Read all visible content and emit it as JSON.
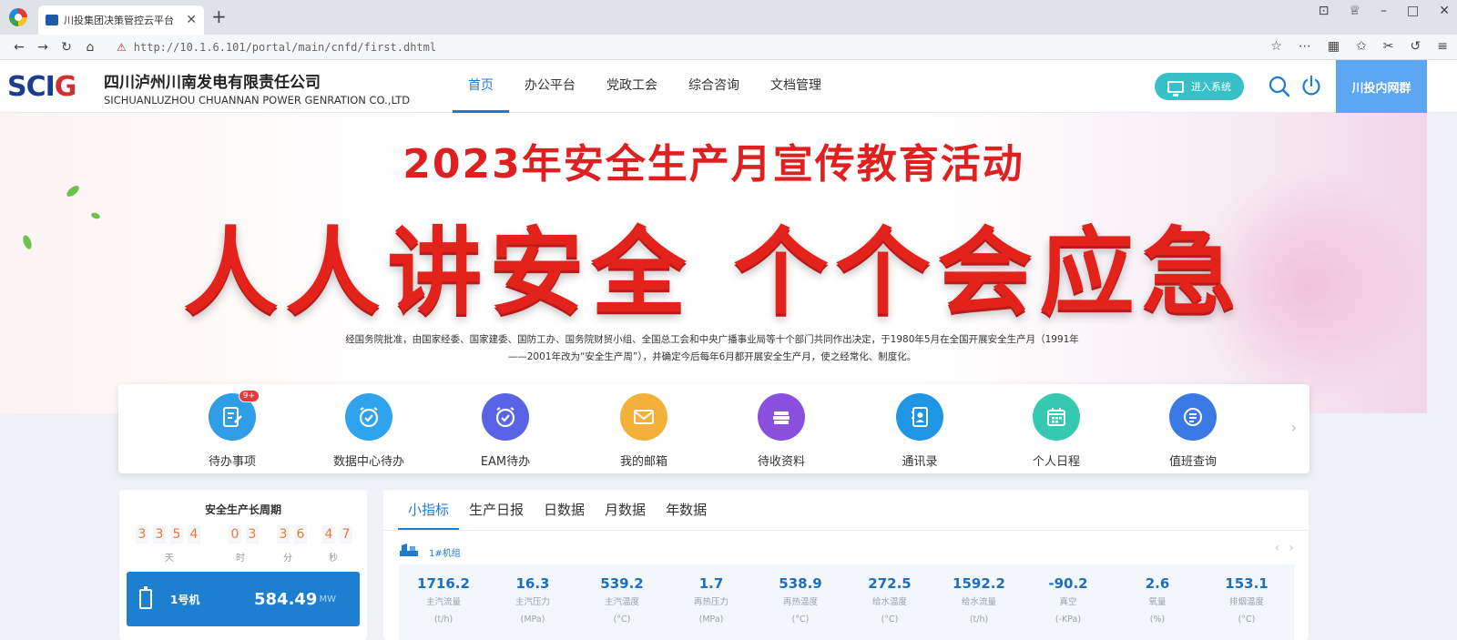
{
  "browser": {
    "tab_title": "川投集团决策管控云平台",
    "url": "http://10.1.6.101/portal/main/cnfd/first.dhtml"
  },
  "header": {
    "logo_text_main": "SCI",
    "logo_text_g": "G",
    "company_cn": "四川泸州川南发电有限责任公司",
    "company_en": "SICHUANLUZHOU CHUANNAN POWER GENRATION CO.,LTD",
    "nav": [
      "首页",
      "办公平台",
      "党政工会",
      "综合咨询",
      "文档管理"
    ],
    "enter_system": "进入系统",
    "intranet": "川投内网群"
  },
  "banner": {
    "title": "2023年安全生产月宣传教育活动",
    "slogan": "人人讲安全 个个会应急",
    "description_line1": "经国务院批准，由国家经委、国家建委、国防工办、国务院财贸小组、全国总工会和中央广播事业局等十个部门共同作出决定，于1980年5月在全国开展安全生产月（1991年",
    "description_line2": "——2001年改为“安全生产周”），并确定今后每年6月都开展安全生产月，使之经常化、制度化。"
  },
  "quick_links": [
    {
      "label": "待办事项",
      "icon": "edit-document-icon",
      "color": "#2f9ee6",
      "badge": "9+"
    },
    {
      "label": "数据中心待办",
      "icon": "alarm-clock-icon",
      "color": "#2fa3ee",
      "badge": ""
    },
    {
      "label": "EAM待办",
      "icon": "alarm-clock-icon",
      "color": "#5a63e6",
      "badge": ""
    },
    {
      "label": "我的邮箱",
      "icon": "envelope-icon",
      "color": "#f4b13a",
      "badge": ""
    },
    {
      "label": "待收资料",
      "icon": "stack-icon",
      "color": "#8b4fe0",
      "badge": ""
    },
    {
      "label": "通讯录",
      "icon": "contacts-book-icon",
      "color": "#1f95e6",
      "badge": ""
    },
    {
      "label": "个人日程",
      "icon": "calendar-icon",
      "color": "#34c9b0",
      "badge": ""
    },
    {
      "label": "值班查询",
      "icon": "list-check-icon",
      "color": "#3a78e6",
      "badge": ""
    }
  ],
  "safety": {
    "title": "安全生产长周期",
    "days": [
      "3",
      "3",
      "5",
      "4"
    ],
    "hours": [
      "0",
      "3"
    ],
    "minutes": [
      "3",
      "6"
    ],
    "seconds": [
      "4",
      "7"
    ],
    "unit_day": "天",
    "unit_hour": "时",
    "unit_min": "分",
    "unit_sec": "秒",
    "unit_card": {
      "name": "1号机",
      "value": "584.49",
      "unit": "MW"
    }
  },
  "metrics": {
    "tabs": [
      "小指标",
      "生产日报",
      "日数据",
      "月数据",
      "年数据"
    ],
    "generator_label": "1#机组",
    "items": [
      {
        "value": "1716.2",
        "name": "主汽流量",
        "unit": "(t/h)"
      },
      {
        "value": "16.3",
        "name": "主汽压力",
        "unit": "(MPa)"
      },
      {
        "value": "539.2",
        "name": "主汽温度",
        "unit": "(°C)"
      },
      {
        "value": "1.7",
        "name": "再热压力",
        "unit": "(MPa)"
      },
      {
        "value": "538.9",
        "name": "再热温度",
        "unit": "(°C)"
      },
      {
        "value": "272.5",
        "name": "给水温度",
        "unit": "(°C)"
      },
      {
        "value": "1592.2",
        "name": "给水流量",
        "unit": "(t/h)"
      },
      {
        "value": "-90.2",
        "name": "真空",
        "unit": "(-KPa)"
      },
      {
        "value": "2.6",
        "name": "氧量",
        "unit": "(%)"
      },
      {
        "value": "153.1",
        "name": "排烟温度",
        "unit": "(°C)"
      }
    ]
  }
}
